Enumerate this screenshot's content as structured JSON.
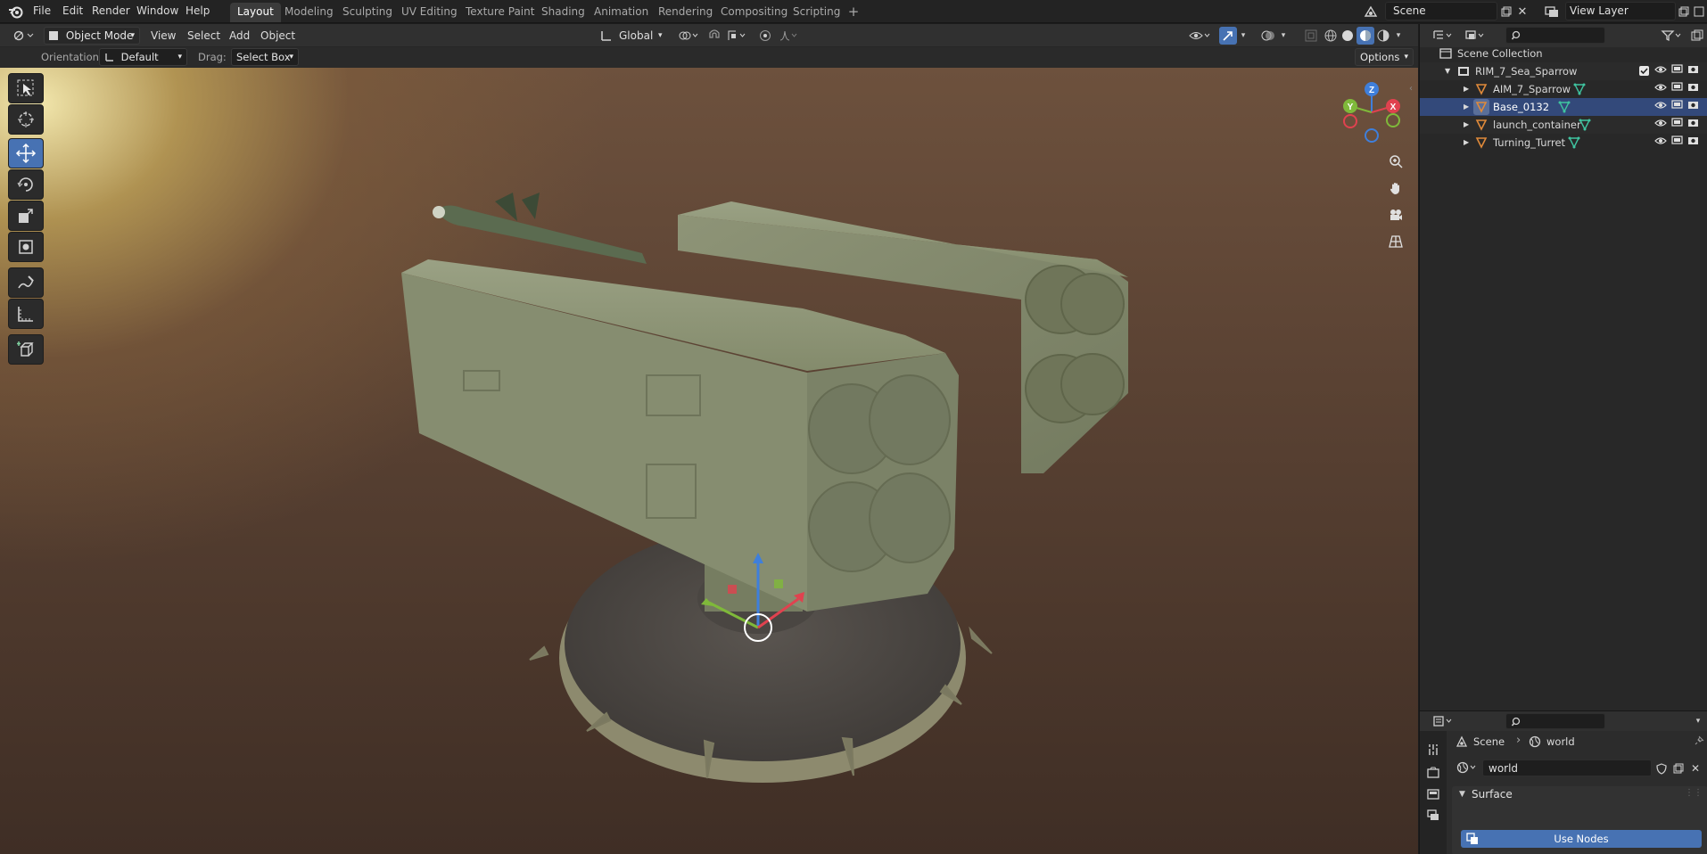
{
  "menu": [
    "File",
    "Edit",
    "Render",
    "Window",
    "Help"
  ],
  "workspaces": [
    "Layout",
    "Modeling",
    "Sculpting",
    "UV Editing",
    "Texture Paint",
    "Shading",
    "Animation",
    "Rendering",
    "Compositing",
    "Scripting"
  ],
  "active_workspace": "Layout",
  "scene_name": "Scene",
  "view_layer": "View Layer",
  "viewport_header": {
    "mode": "Object Mode",
    "view": "View",
    "select": "Select",
    "add": "Add",
    "object": "Object",
    "transform_orientation": "Global"
  },
  "tool_settings": {
    "orientation_label": "Orientation:",
    "orientation_value": "Default",
    "drag_label": "Drag:",
    "drag_value": "Select Box",
    "options": "Options"
  },
  "gizmo_axes": {
    "x": "X",
    "y": "Y",
    "z": "Z"
  },
  "outliner": {
    "root": "Scene Collection",
    "collection": "RIM_7_Sea_Sparrow",
    "objects": [
      {
        "name": "AIM_7_Sparrow",
        "selected": false
      },
      {
        "name": "Base_0132",
        "selected": true
      },
      {
        "name": "launch_container",
        "selected": false
      },
      {
        "name": "Turning_Turret",
        "selected": false
      }
    ]
  },
  "properties": {
    "breadcrumb_scene": "Scene",
    "breadcrumb_world": "world",
    "world_name": "world",
    "panel_surface": "Surface",
    "use_nodes": "Use Nodes"
  },
  "colors": {
    "accent": "#4772b3",
    "selected_row": "#33497a",
    "axis_x": "#e0424f",
    "axis_y": "#7fb93a",
    "axis_z": "#3f7fdb",
    "mesh_icon": "#e08a3a",
    "object_data": "#3fc4a0"
  }
}
